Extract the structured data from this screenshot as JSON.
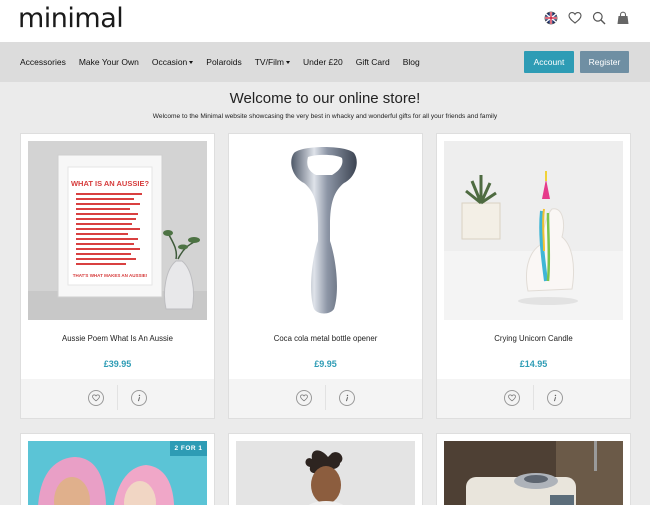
{
  "header": {
    "logo": "minimal",
    "icons": [
      "flag-icon",
      "heart-icon",
      "search-icon",
      "bag-icon"
    ]
  },
  "nav": {
    "items": [
      {
        "label": "Accessories",
        "dropdown": false
      },
      {
        "label": "Make Your Own",
        "dropdown": false
      },
      {
        "label": "Occasion",
        "dropdown": true
      },
      {
        "label": "Polaroids",
        "dropdown": false
      },
      {
        "label": "TV/Film",
        "dropdown": true
      },
      {
        "label": "Under £20",
        "dropdown": false
      },
      {
        "label": "Gift Card",
        "dropdown": false
      },
      {
        "label": "Blog",
        "dropdown": false
      }
    ],
    "account_label": "Account",
    "register_label": "Register"
  },
  "main": {
    "title": "Welcome to our online store!",
    "subtitle": "Welcome to the Minimal website showcasing the very best in whacky and wonderful gifts for all your friends and family"
  },
  "products": [
    {
      "name": "Aussie Poem What Is An Aussie",
      "price": "£39.95"
    },
    {
      "name": "Coca cola metal bottle opener",
      "price": "£9.95"
    },
    {
      "name": "Crying Unicorn Candle",
      "price": "£14.95"
    },
    {
      "badge": "2 FOR 1"
    },
    {},
    {}
  ],
  "poster": {
    "heading": "WHAT IS AN AUSSIE?",
    "footer": "THAT'S WHAT MAKES AN AUSSIE!"
  },
  "colors": {
    "accent": "#2e9cb5",
    "register": "#6f8fa3",
    "nav_bg": "#dcdcdc",
    "page_bg": "#ebebeb"
  }
}
